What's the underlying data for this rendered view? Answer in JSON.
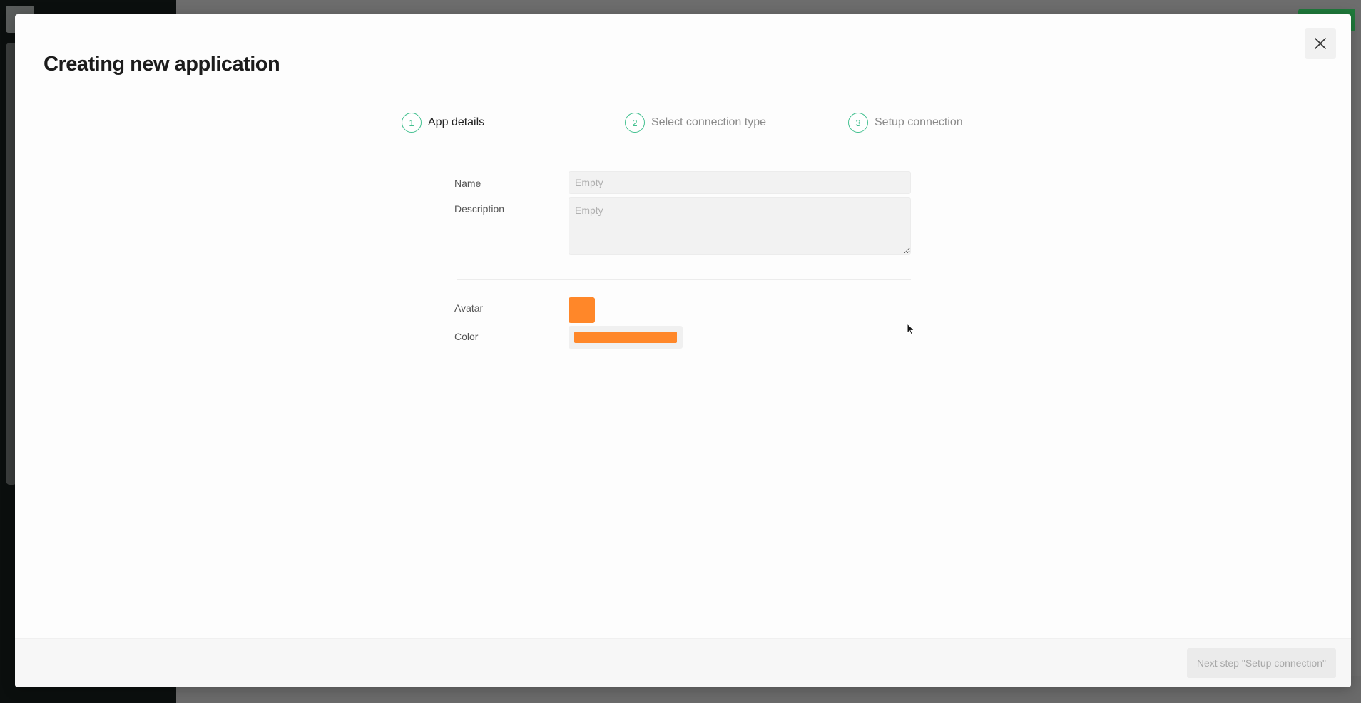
{
  "modal": {
    "title": "Creating new application",
    "close_icon": "close-icon"
  },
  "stepper": {
    "steps": [
      {
        "number": "1",
        "label": "App details",
        "active": true
      },
      {
        "number": "2",
        "label": "Select connection type",
        "active": false
      },
      {
        "number": "3",
        "label": "Setup connection",
        "active": false
      }
    ],
    "accent_color": "#42c08f"
  },
  "form": {
    "name_label": "Name",
    "name_value": "",
    "name_placeholder": "Empty",
    "description_label": "Description",
    "description_value": "",
    "description_placeholder": "Empty",
    "avatar_label": "Avatar",
    "color_label": "Color",
    "selected_color": "#ff8729"
  },
  "footer": {
    "next_button_label": "Next step \"Setup connection\""
  }
}
